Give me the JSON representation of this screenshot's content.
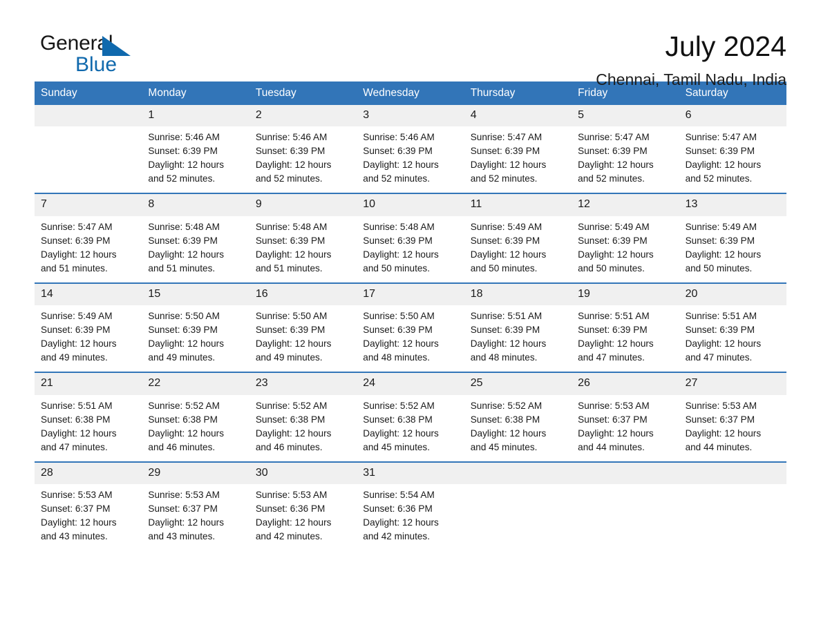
{
  "logo": {
    "word_one": "General",
    "word_two": "Blue",
    "triangle_color": "#1069ad",
    "text_color": "#161616"
  },
  "header": {
    "title": "July 2024",
    "subtitle": "Chennai, Tamil Nadu, India"
  },
  "colors": {
    "header_blue": "#3275b8",
    "daynum_band": "#f0f0f0",
    "text": "#1a1a1a",
    "white": "#ffffff"
  },
  "calendar": {
    "day_headers": [
      "Sunday",
      "Monday",
      "Tuesday",
      "Wednesday",
      "Thursday",
      "Friday",
      "Saturday"
    ],
    "weeks": [
      [
        {
          "day": "",
          "lines": []
        },
        {
          "day": "1",
          "lines": [
            "Sunrise: 5:46 AM",
            "Sunset: 6:39 PM",
            "Daylight: 12 hours",
            "and 52 minutes."
          ]
        },
        {
          "day": "2",
          "lines": [
            "Sunrise: 5:46 AM",
            "Sunset: 6:39 PM",
            "Daylight: 12 hours",
            "and 52 minutes."
          ]
        },
        {
          "day": "3",
          "lines": [
            "Sunrise: 5:46 AM",
            "Sunset: 6:39 PM",
            "Daylight: 12 hours",
            "and 52 minutes."
          ]
        },
        {
          "day": "4",
          "lines": [
            "Sunrise: 5:47 AM",
            "Sunset: 6:39 PM",
            "Daylight: 12 hours",
            "and 52 minutes."
          ]
        },
        {
          "day": "5",
          "lines": [
            "Sunrise: 5:47 AM",
            "Sunset: 6:39 PM",
            "Daylight: 12 hours",
            "and 52 minutes."
          ]
        },
        {
          "day": "6",
          "lines": [
            "Sunrise: 5:47 AM",
            "Sunset: 6:39 PM",
            "Daylight: 12 hours",
            "and 52 minutes."
          ]
        }
      ],
      [
        {
          "day": "7",
          "lines": [
            "Sunrise: 5:47 AM",
            "Sunset: 6:39 PM",
            "Daylight: 12 hours",
            "and 51 minutes."
          ]
        },
        {
          "day": "8",
          "lines": [
            "Sunrise: 5:48 AM",
            "Sunset: 6:39 PM",
            "Daylight: 12 hours",
            "and 51 minutes."
          ]
        },
        {
          "day": "9",
          "lines": [
            "Sunrise: 5:48 AM",
            "Sunset: 6:39 PM",
            "Daylight: 12 hours",
            "and 51 minutes."
          ]
        },
        {
          "day": "10",
          "lines": [
            "Sunrise: 5:48 AM",
            "Sunset: 6:39 PM",
            "Daylight: 12 hours",
            "and 50 minutes."
          ]
        },
        {
          "day": "11",
          "lines": [
            "Sunrise: 5:49 AM",
            "Sunset: 6:39 PM",
            "Daylight: 12 hours",
            "and 50 minutes."
          ]
        },
        {
          "day": "12",
          "lines": [
            "Sunrise: 5:49 AM",
            "Sunset: 6:39 PM",
            "Daylight: 12 hours",
            "and 50 minutes."
          ]
        },
        {
          "day": "13",
          "lines": [
            "Sunrise: 5:49 AM",
            "Sunset: 6:39 PM",
            "Daylight: 12 hours",
            "and 50 minutes."
          ]
        }
      ],
      [
        {
          "day": "14",
          "lines": [
            "Sunrise: 5:49 AM",
            "Sunset: 6:39 PM",
            "Daylight: 12 hours",
            "and 49 minutes."
          ]
        },
        {
          "day": "15",
          "lines": [
            "Sunrise: 5:50 AM",
            "Sunset: 6:39 PM",
            "Daylight: 12 hours",
            "and 49 minutes."
          ]
        },
        {
          "day": "16",
          "lines": [
            "Sunrise: 5:50 AM",
            "Sunset: 6:39 PM",
            "Daylight: 12 hours",
            "and 49 minutes."
          ]
        },
        {
          "day": "17",
          "lines": [
            "Sunrise: 5:50 AM",
            "Sunset: 6:39 PM",
            "Daylight: 12 hours",
            "and 48 minutes."
          ]
        },
        {
          "day": "18",
          "lines": [
            "Sunrise: 5:51 AM",
            "Sunset: 6:39 PM",
            "Daylight: 12 hours",
            "and 48 minutes."
          ]
        },
        {
          "day": "19",
          "lines": [
            "Sunrise: 5:51 AM",
            "Sunset: 6:39 PM",
            "Daylight: 12 hours",
            "and 47 minutes."
          ]
        },
        {
          "day": "20",
          "lines": [
            "Sunrise: 5:51 AM",
            "Sunset: 6:39 PM",
            "Daylight: 12 hours",
            "and 47 minutes."
          ]
        }
      ],
      [
        {
          "day": "21",
          "lines": [
            "Sunrise: 5:51 AM",
            "Sunset: 6:38 PM",
            "Daylight: 12 hours",
            "and 47 minutes."
          ]
        },
        {
          "day": "22",
          "lines": [
            "Sunrise: 5:52 AM",
            "Sunset: 6:38 PM",
            "Daylight: 12 hours",
            "and 46 minutes."
          ]
        },
        {
          "day": "23",
          "lines": [
            "Sunrise: 5:52 AM",
            "Sunset: 6:38 PM",
            "Daylight: 12 hours",
            "and 46 minutes."
          ]
        },
        {
          "day": "24",
          "lines": [
            "Sunrise: 5:52 AM",
            "Sunset: 6:38 PM",
            "Daylight: 12 hours",
            "and 45 minutes."
          ]
        },
        {
          "day": "25",
          "lines": [
            "Sunrise: 5:52 AM",
            "Sunset: 6:38 PM",
            "Daylight: 12 hours",
            "and 45 minutes."
          ]
        },
        {
          "day": "26",
          "lines": [
            "Sunrise: 5:53 AM",
            "Sunset: 6:37 PM",
            "Daylight: 12 hours",
            "and 44 minutes."
          ]
        },
        {
          "day": "27",
          "lines": [
            "Sunrise: 5:53 AM",
            "Sunset: 6:37 PM",
            "Daylight: 12 hours",
            "and 44 minutes."
          ]
        }
      ],
      [
        {
          "day": "28",
          "lines": [
            "Sunrise: 5:53 AM",
            "Sunset: 6:37 PM",
            "Daylight: 12 hours",
            "and 43 minutes."
          ]
        },
        {
          "day": "29",
          "lines": [
            "Sunrise: 5:53 AM",
            "Sunset: 6:37 PM",
            "Daylight: 12 hours",
            "and 43 minutes."
          ]
        },
        {
          "day": "30",
          "lines": [
            "Sunrise: 5:53 AM",
            "Sunset: 6:36 PM",
            "Daylight: 12 hours",
            "and 42 minutes."
          ]
        },
        {
          "day": "31",
          "lines": [
            "Sunrise: 5:54 AM",
            "Sunset: 6:36 PM",
            "Daylight: 12 hours",
            "and 42 minutes."
          ]
        },
        {
          "day": "",
          "lines": []
        },
        {
          "day": "",
          "lines": []
        },
        {
          "day": "",
          "lines": []
        }
      ]
    ]
  }
}
